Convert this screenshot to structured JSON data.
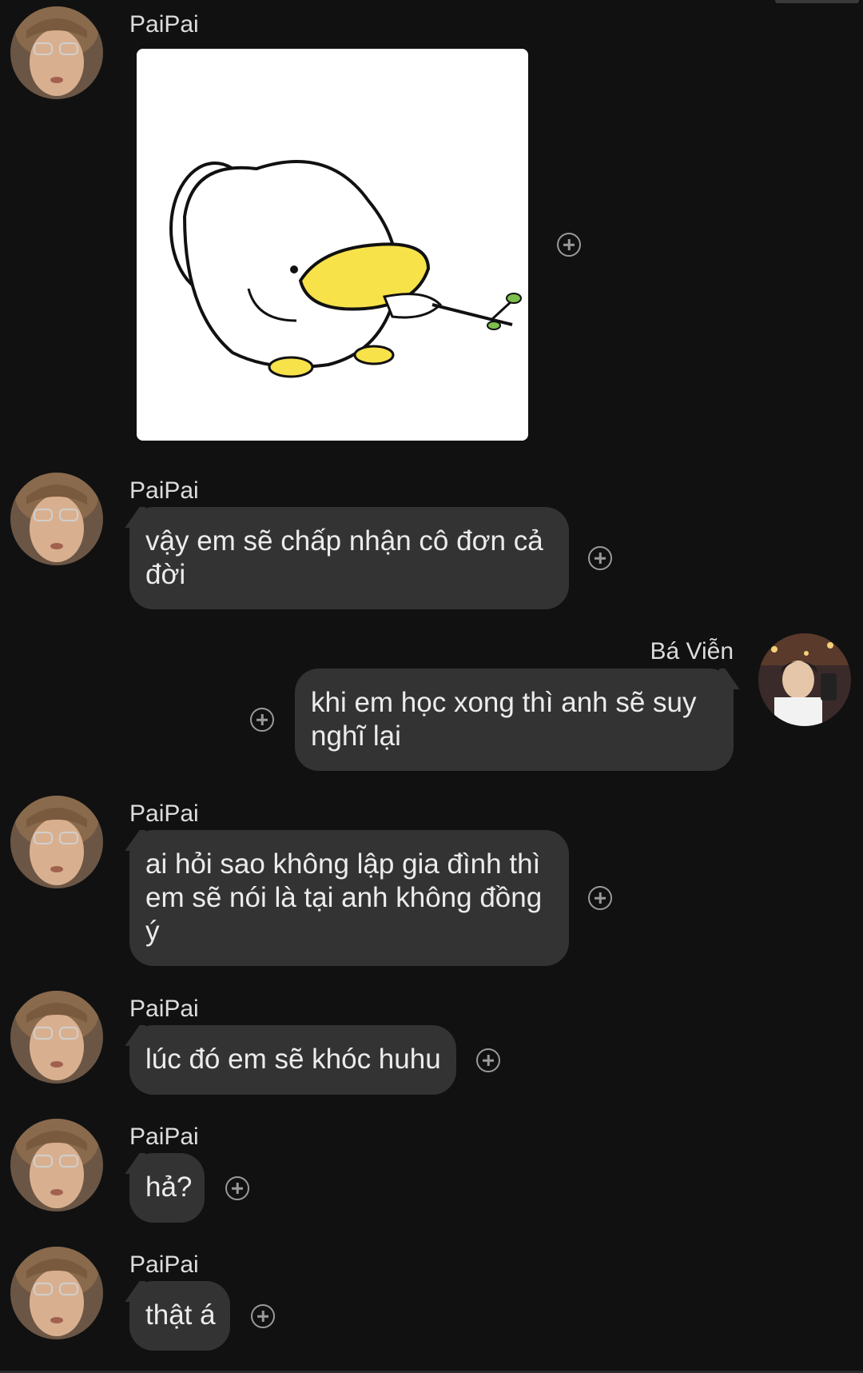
{
  "messages": [
    {
      "sender": "PaiPai",
      "type": "sticker",
      "sticker_name": "white-duck-sticker"
    },
    {
      "sender": "PaiPai",
      "type": "text",
      "text": "vậy em sẽ chấp nhận cô đơn cả đời"
    },
    {
      "sender": "Bá Viễn",
      "type": "text",
      "text": "khi em học xong thì anh sẽ suy nghĩ lại"
    },
    {
      "sender": "PaiPai",
      "type": "text",
      "text": "ai hỏi sao không lập gia đình thì em sẽ nói là tại anh không đồng ý"
    },
    {
      "sender": "PaiPai",
      "type": "text",
      "text": "lúc đó em sẽ khóc huhu"
    },
    {
      "sender": "PaiPai",
      "type": "text",
      "text": "hả?"
    },
    {
      "sender": "PaiPai",
      "type": "text",
      "text": "thật á"
    }
  ],
  "icons": {
    "add_reaction": "plus-circle-icon"
  },
  "colors": {
    "background": "#111111",
    "bubble": "#333333",
    "text": "#ececec",
    "sticker_yellow": "#f7e24a"
  }
}
